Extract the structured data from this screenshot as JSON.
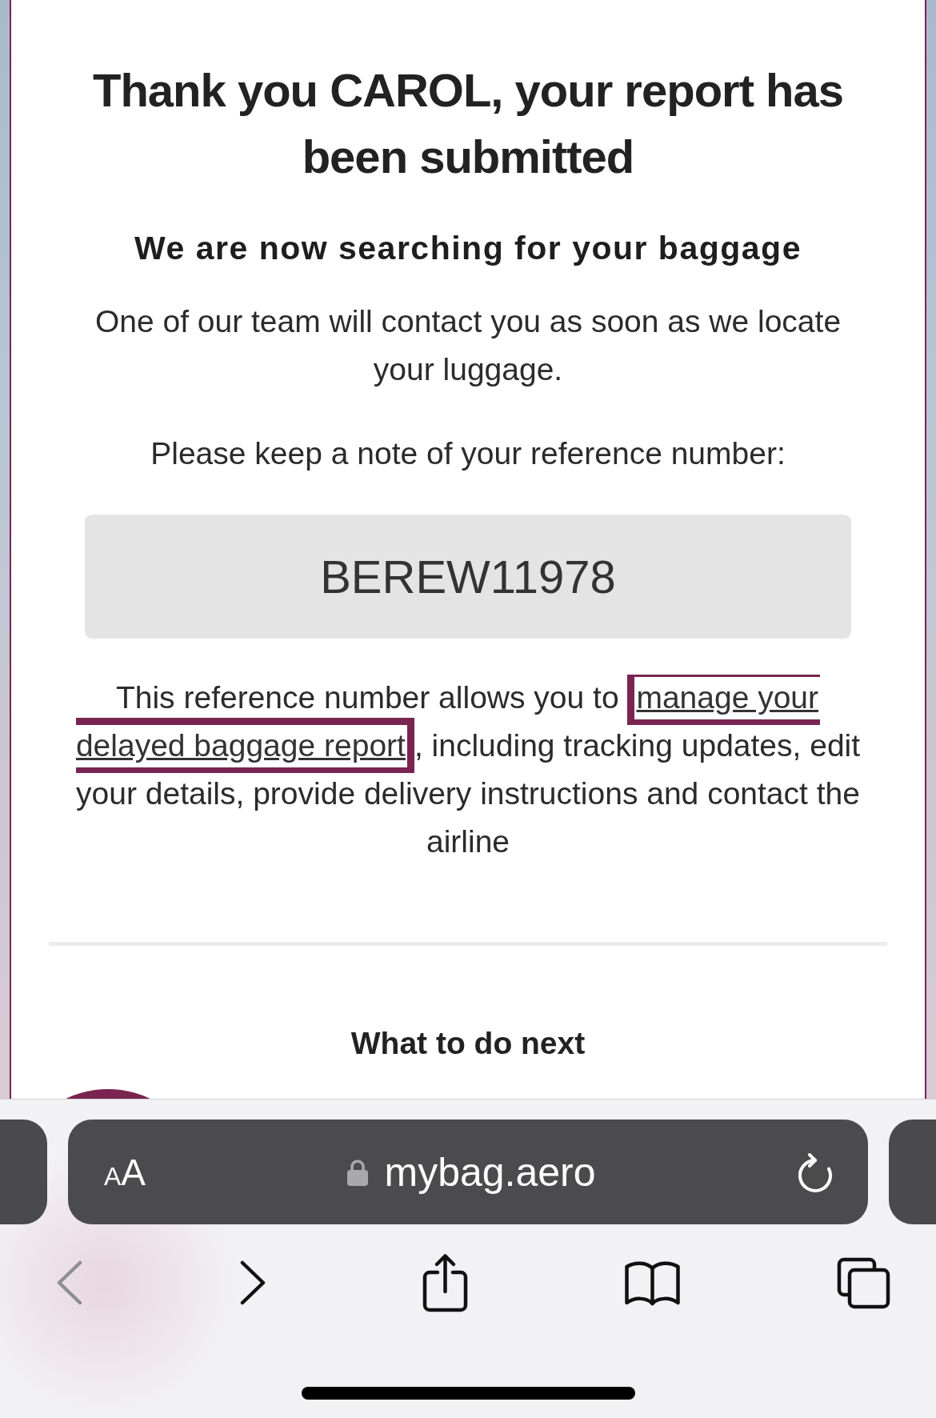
{
  "page": {
    "title": "Thank you CAROL, your report has been submitted",
    "subtitle": "We are now searching for your baggage",
    "message": "One of our team will contact you as soon as we locate your luggage.",
    "reference_prompt": "Please keep a note of your reference number:",
    "reference_number": "BEREW11978",
    "reference_info": {
      "before": "This reference number allows you to ",
      "link": {
        "parts": [
          "manage your",
          "delayed baggage report"
        ],
        "focused": true
      },
      "after": ", including tracking updates, edit your details, provide delivery instructions and contact the airline"
    },
    "next_heading": "What to do next"
  },
  "browser": {
    "address_bar": {
      "text_size_label": "AA",
      "url": "mybag.aero",
      "secure": true
    },
    "toolbar": [
      {
        "kind": "back",
        "disabled": true
      },
      {
        "kind": "forward",
        "disabled": false
      },
      {
        "kind": "share",
        "disabled": false
      },
      {
        "kind": "bookmarks",
        "disabled": false
      },
      {
        "kind": "tabs",
        "disabled": false
      }
    ]
  }
}
